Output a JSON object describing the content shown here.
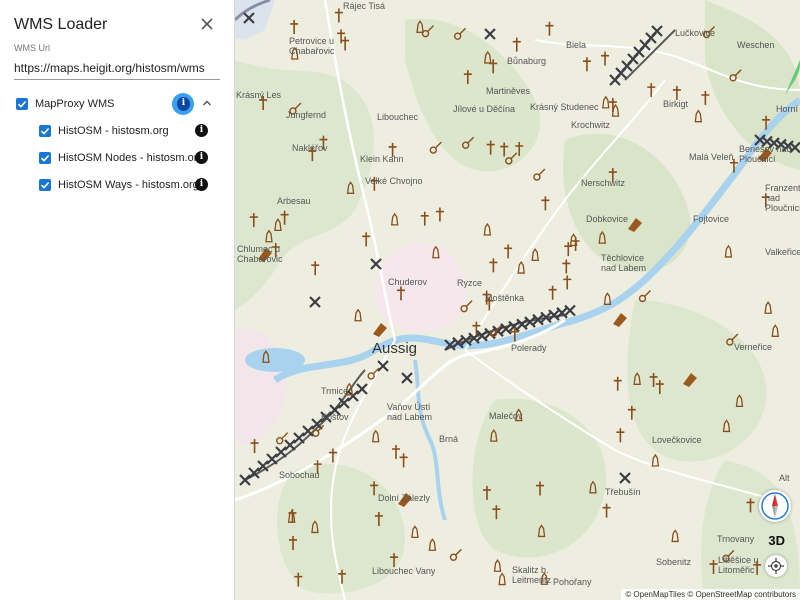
{
  "panel": {
    "title": "WMS Loader",
    "close_icon": "close-icon",
    "url_label": "WMS Url",
    "url_value": "https://maps.heigit.org/histosm/wms",
    "group": {
      "label": "MapProxy WMS",
      "checked": true
    },
    "layers": [
      {
        "label": "HistOSM - histosm.org",
        "checked": true
      },
      {
        "label": "HistOSM Nodes - histosm.org",
        "checked": true
      },
      {
        "label": "HistOSM Ways - histosm.org",
        "checked": true
      }
    ]
  },
  "map": {
    "places": [
      "Rájec Tisá",
      "Petrovice u Chabařovic",
      "Krásný Les",
      "Jungfernd",
      "Libouchec",
      "Nakléřov",
      "Arbesau",
      "Klein Kahn",
      "Velké Chvojno",
      "Chlumec u Chabařovic",
      "Chuderov",
      "Ryzce",
      "Moštěnka",
      "Aussig",
      "Trmice",
      "Koštov",
      "Vaňov Ústí nad Labem",
      "Malečov",
      "Brná",
      "Sobochau",
      "Dolní Zálezly",
      "Libouchec Vany",
      "Skalitz b. Leitmeritz",
      "Pohořany",
      "Martiněves",
      "Jílové u Děčína",
      "Krásný Studenec",
      "Krochwitz",
      "Bůnaburg",
      "Biela",
      "Lučkovice",
      "Weschen",
      "Birkigt",
      "Benešov nad Ploučnicí",
      "Malá Veleň",
      "Nerschwitz",
      "Dobkovice",
      "Těchlovice nad Labem",
      "Fojtovice",
      "Valkeřice",
      "Franzental nad Ploučnicí",
      "Verneřice",
      "Lovečkovice",
      "Třebušín",
      "Sobenitz",
      "Trnovany",
      "Liběšice u Litoměřic",
      "Horní",
      "Alt",
      "Polerady"
    ],
    "attribution": "© OpenMapTiles © OpenStreetMap contributors",
    "btn_3d": "3D",
    "compass_icon": "compass-icon",
    "locate_icon": "locate-icon"
  }
}
